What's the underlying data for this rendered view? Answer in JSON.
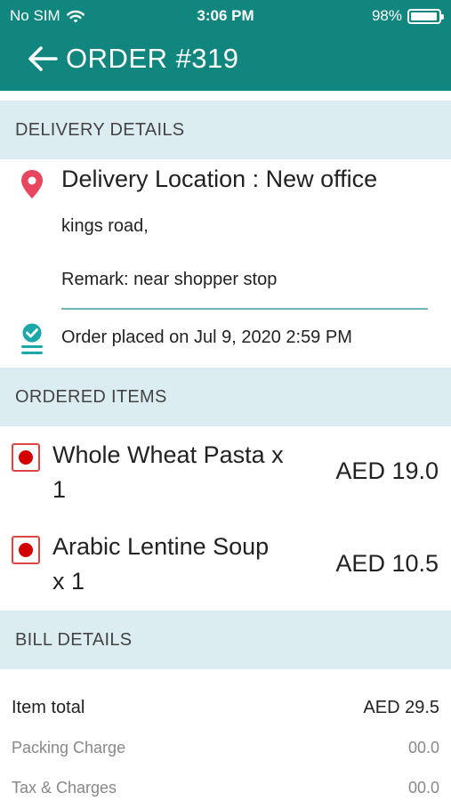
{
  "status_bar": {
    "carrier": "No SIM",
    "time": "3:06 PM",
    "battery": "98%",
    "battery_level": 0.98
  },
  "header": {
    "title": "ORDER #319"
  },
  "delivery": {
    "section_title": "DELIVERY DETAILS",
    "location_title": "Delivery Location : New office",
    "address": "kings road,",
    "remark": "Remark: near shopper stop",
    "placed_on": "Order placed on Jul 9, 2020 2:59 PM"
  },
  "ordered": {
    "section_title": "ORDERED ITEMS",
    "items": [
      {
        "name": "Whole Wheat Pasta x 1",
        "price": "AED 19.0"
      },
      {
        "name": "Arabic Lentine Soup x 1",
        "price": "AED 10.5"
      }
    ]
  },
  "bill": {
    "section_title": "BILL DETAILS",
    "item_total_label": "Item total",
    "item_total_value": "AED 29.5",
    "packing_label": "Packing Charge",
    "packing_value": "00.0",
    "tax_label": "Tax & Charges",
    "tax_value": "00.0"
  },
  "colors": {
    "header": "#11867f",
    "section_bg": "#dcedf1",
    "pin": "#e8455e",
    "accent": "#1aa9a8",
    "non_veg_dot": "#d20000"
  }
}
